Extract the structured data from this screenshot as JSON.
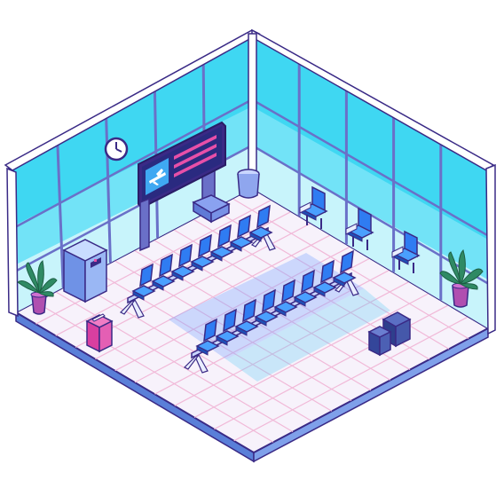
{
  "scene": {
    "kind": "isometric airport departure lounge",
    "style": "pixel art",
    "objects": [
      "wall-clock",
      "flight-departures-board",
      "airplane-icon",
      "trash-bin",
      "info-kiosk",
      "potted-plant",
      "waiting-bench-row",
      "armchair",
      "magenta-suitcase",
      "luggage-bags"
    ]
  },
  "colors": {
    "floor": "#f7f2fb",
    "floor_grid": "#f1b9d8",
    "floor_grid_front": "#b7d2f2",
    "window_glass": "#3fd7f2",
    "window_glass_light": "#c8f4fb",
    "frame": "#6a70c8",
    "outline": "#3a2a86",
    "seat": "#2f7cf2",
    "seat_dark": "#1f4fb6",
    "board": "#3a2a86",
    "board_text": "#e84fa8",
    "plant": "#2f8a64",
    "pot": "#b04fb0",
    "suitcase": "#d83fa0",
    "luggage": "#3a4c9a"
  }
}
